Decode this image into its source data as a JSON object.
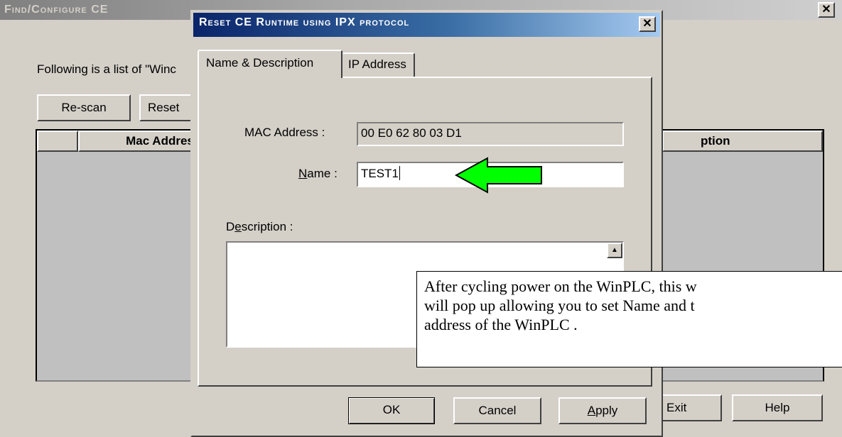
{
  "background_window": {
    "title": "Find/Configure CE",
    "intro_text": "Following is a list of \"Winc",
    "buttons": {
      "rescan": "Re-scan",
      "reset": "Reset"
    },
    "table": {
      "columns": [
        "",
        "Mac Addres",
        "ption"
      ]
    },
    "bottom_buttons": {
      "exit": "Exit",
      "help": "Help"
    },
    "close_icon": "close-icon"
  },
  "dialog": {
    "title": "Reset CE Runtime using IPX protocol",
    "tabs": [
      {
        "label": "Name & Description",
        "active": true
      },
      {
        "label": "IP Address",
        "active": false
      }
    ],
    "fields": {
      "mac_label": "MAC Address :",
      "mac_value": "00 E0 62 80 03 D1",
      "name_label_prefix": "",
      "name_label_mnemonic": "N",
      "name_label_rest": "ame :",
      "name_value": "TEST1",
      "description_label_prefix": "D",
      "description_label_mnemonic": "e",
      "description_label_rest": "scription :",
      "description_value": ""
    },
    "buttons": {
      "ok": "OK",
      "cancel": "Cancel",
      "apply_mnemonic": "A",
      "apply_rest": "pply"
    },
    "close_icon": "close-icon"
  },
  "annotation": {
    "callout_text": "After cycling power on the WinPLC, this w will pop up allowing you to set Name and t address of the WinPLC .",
    "callout_lines": [
      "After cycling power on the WinPLC, this w",
      "will pop up allowing you to set Name and t",
      "address of the WinPLC ."
    ],
    "arrow_color": "#00ff00",
    "arrow_icon": "green-arrow-left-icon"
  },
  "colors": {
    "face": "#d4d0c8",
    "active_title_start": "#0a246a",
    "active_title_end": "#a6caf0",
    "inactive_title": "#808080"
  }
}
